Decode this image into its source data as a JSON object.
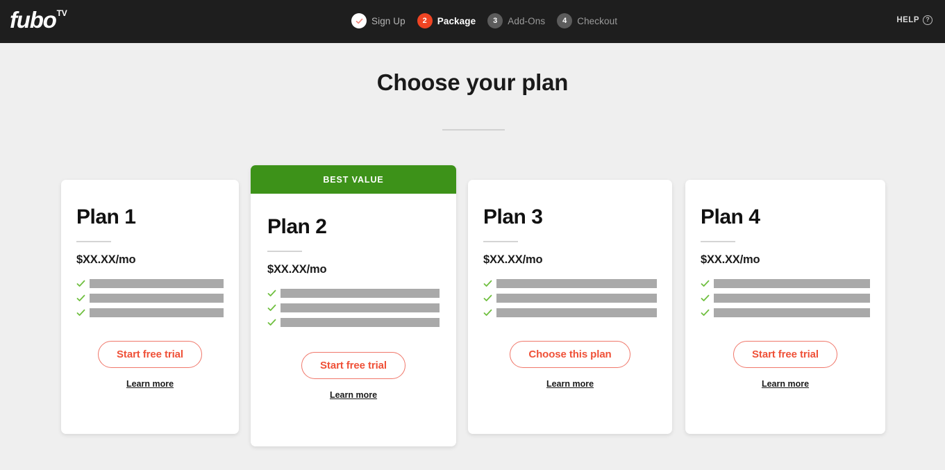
{
  "header": {
    "logo_word": "fubo",
    "logo_sup": "TV",
    "help_label": "HELP",
    "help_icon": "question-mark-circle-icon",
    "steps": [
      {
        "badge": "✓",
        "label": "Sign Up",
        "state": "done"
      },
      {
        "badge": "2",
        "label": "Package",
        "state": "active"
      },
      {
        "badge": "3",
        "label": "Add-Ons",
        "state": "todo"
      },
      {
        "badge": "4",
        "label": "Checkout",
        "state": "todo"
      }
    ]
  },
  "main": {
    "title": "Choose your plan",
    "plans": [
      {
        "name": "Plan 1",
        "price": "$XX.XX/mo",
        "banner": null,
        "features": [
          "",
          "",
          ""
        ],
        "cta_label": "Start free trial",
        "learn_more_label": "Learn more"
      },
      {
        "name": "Plan 2",
        "price": "$XX.XX/mo",
        "banner": "BEST VALUE",
        "features": [
          "",
          "",
          ""
        ],
        "cta_label": "Start free trial",
        "learn_more_label": "Learn more"
      },
      {
        "name": "Plan 3",
        "price": "$XX.XX/mo",
        "banner": null,
        "features": [
          "",
          "",
          ""
        ],
        "cta_label": "Choose this plan",
        "learn_more_label": "Learn more"
      },
      {
        "name": "Plan 4",
        "price": "$XX.XX/mo",
        "banner": null,
        "features": [
          "",
          "",
          ""
        ],
        "cta_label": "Start free trial",
        "learn_more_label": "Learn more"
      }
    ]
  },
  "colors": {
    "header_bg": "#1e1e1e",
    "page_bg": "#efefef",
    "accent_red": "#ef5138",
    "active_step": "#ef4423",
    "best_value_green": "#3d9219",
    "check_green": "#6fbf3f",
    "placeholder_gray": "#a9a9a9"
  }
}
